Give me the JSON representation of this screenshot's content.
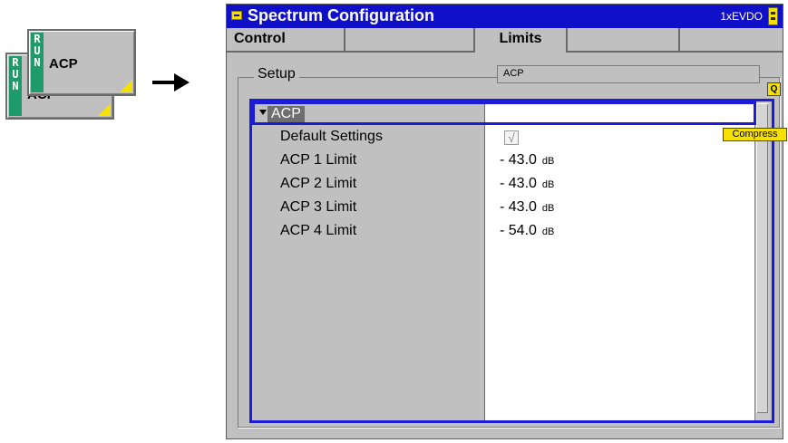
{
  "softkeys": {
    "back": {
      "label": "ACP",
      "run_text": "RUN"
    },
    "front": {
      "label": "ACP",
      "run_text": "RUN"
    }
  },
  "window": {
    "title": "Spectrum Configuration",
    "standard": "1xEVDO",
    "tabs": [
      {
        "label": "Control",
        "active": false
      },
      {
        "label": "",
        "active": false
      },
      {
        "label": "Limits",
        "active": true
      },
      {
        "label": "",
        "active": false
      },
      {
        "label": "",
        "active": false
      }
    ],
    "setup": {
      "legend": "Setup",
      "selected": "ACP"
    },
    "q_button": "Q",
    "compress_button": "Compress",
    "tree": {
      "node": "ACP",
      "rows": [
        {
          "name": "Default Settings",
          "type": "checkbox",
          "checked": true,
          "check_mark": "√"
        },
        {
          "name": "ACP 1 Limit",
          "value": "- 43.0",
          "unit": "dB"
        },
        {
          "name": "ACP 2 Limit",
          "value": "- 43.0",
          "unit": "dB"
        },
        {
          "name": "ACP 3 Limit",
          "value": "- 43.0",
          "unit": "dB"
        },
        {
          "name": "ACP 4 Limit",
          "value": "- 54.0",
          "unit": "dB"
        }
      ]
    }
  },
  "colors": {
    "title_bar": "#1010c8",
    "focus_border": "#1c1cd8",
    "softkey_run": "#1f9a6a",
    "highlight_yellow": "#f5e000",
    "panel_gray": "#c0c0c0"
  }
}
